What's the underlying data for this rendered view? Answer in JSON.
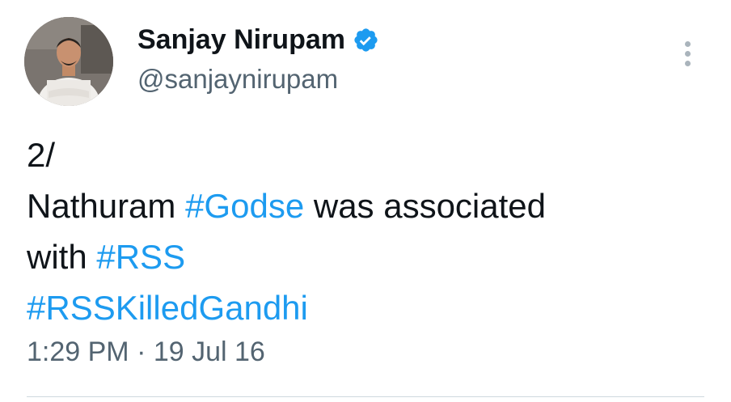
{
  "author": {
    "display_name": "Sanjay Nirupam",
    "handle": "@sanjaynirupam",
    "verified": true,
    "avatar": "profile-photo"
  },
  "tweet": {
    "line1": "2/",
    "line2_pre": "Nathuram ",
    "hashtag_godse": "#Godse",
    "line2_post": " was associated",
    "line3_pre": "with ",
    "hashtag_rss": "#RSS",
    "hashtag_rsskilledgandhi": "#RSSKilledGandhi"
  },
  "meta": {
    "timestamp": "1:29 PM · 19 Jul 16"
  },
  "icons": {
    "verified": "verified-badge-icon",
    "more": "more-options-icon"
  },
  "colors": {
    "hashtag": "#1d9bf0",
    "verified": "#1d9bf0",
    "secondary_text": "#536471",
    "primary_text": "#0f1419"
  }
}
